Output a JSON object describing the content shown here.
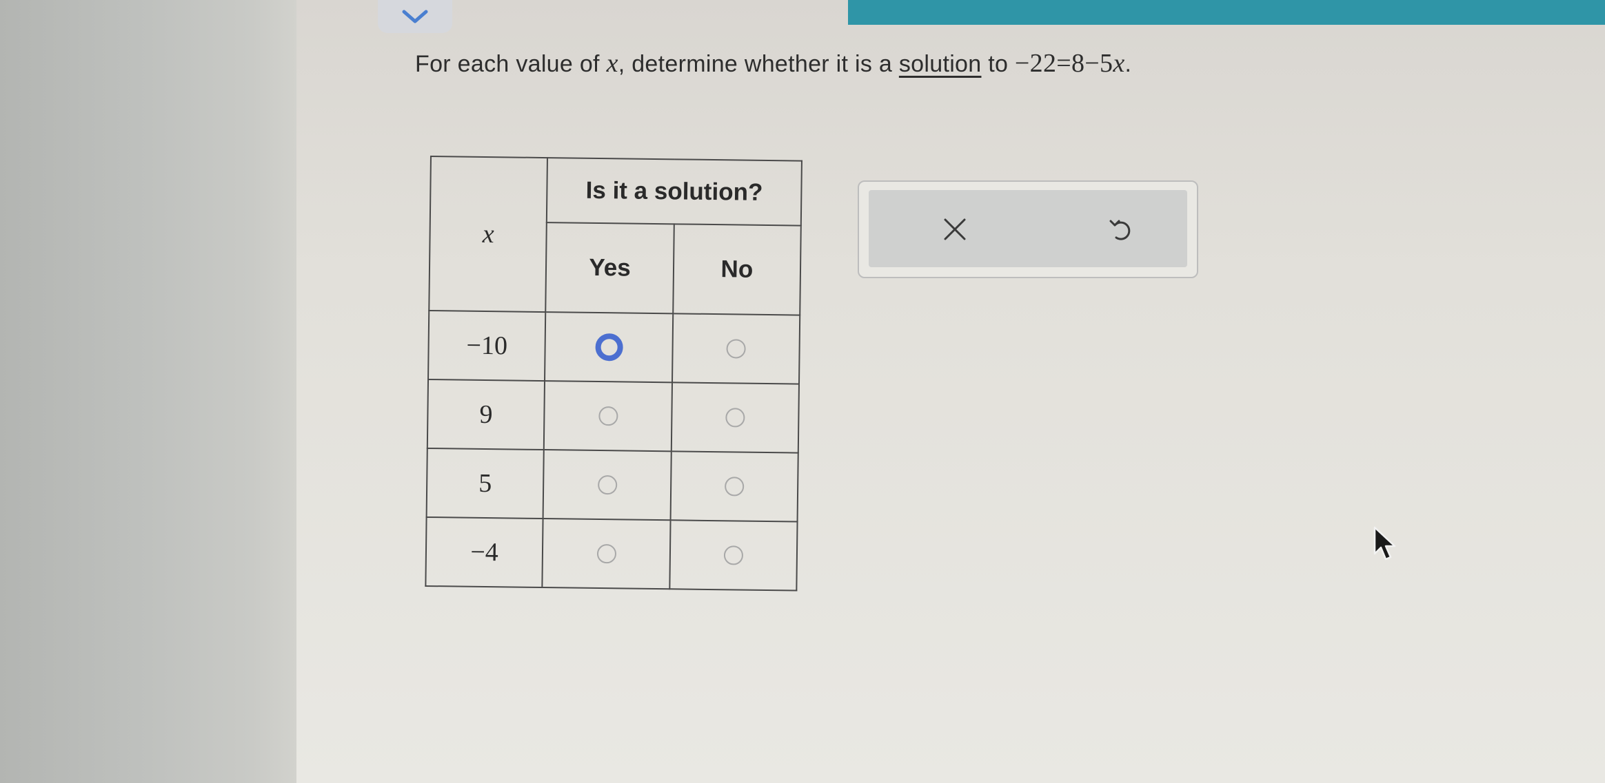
{
  "question": {
    "prefix": "For each value of ",
    "variable": "x",
    "middle": ", determine whether it is a ",
    "link": "solution",
    "to": " to ",
    "equation": "−22=8−5",
    "equation_var": "x",
    "suffix": "."
  },
  "table": {
    "header_group": "Is it a solution?",
    "x_header": "x",
    "yes_header": "Yes",
    "no_header": "No",
    "rows": [
      {
        "x": "−10",
        "selected": "yes"
      },
      {
        "x": "9",
        "selected": null
      },
      {
        "x": "5",
        "selected": null
      },
      {
        "x": "−4",
        "selected": null
      }
    ]
  },
  "tools": {
    "close_icon": "close-icon",
    "undo_icon": "undo-icon"
  },
  "colors": {
    "accent_bar": "#2f95a7",
    "radio_selected": "#4c6fd0"
  }
}
